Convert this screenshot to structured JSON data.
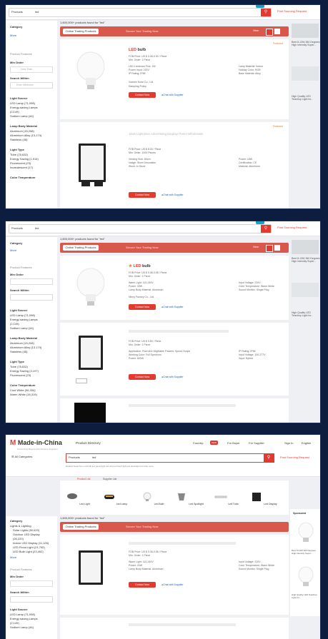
{
  "search": {
    "category": "Products",
    "value": "led"
  },
  "header": {
    "sourcing_request": "Post Sourcing Request"
  },
  "sidebar": {
    "category": "Category",
    "more": "More",
    "product_features": "Product Features",
    "min_order": "Min Order",
    "min_order_placeholder": "Less Than",
    "ok": "OK",
    "search_within": "Search Within",
    "search_within_placeholder": "Enter Attributes",
    "light_source": "Light Source",
    "light_source_items": [
      "LED Lamp (71,098)",
      "Energy-saving Lamps",
      "(2,149)",
      "Sodium Lamp (44)"
    ],
    "lamp_body_material": "Lamp Body Material",
    "lamp_body_items": [
      "Aluminum (15,208)",
      "Aluminium Alloy (13,174)",
      "Stainless (45)"
    ],
    "light_type": "Light Type",
    "light_type_items": [
      "Tube (75,632)",
      "Energy Saving (1,914)",
      "Fluorescent (23)",
      "Incandescent (17)"
    ],
    "color_temperature": "Color Temperature"
  },
  "main": {
    "count_text": "1,600,000+ products found for \"led\"",
    "tab_online": "Online Trading Products",
    "tab_promo": "Secure Your Trading Now",
    "view_label": "View:",
    "featured": "Featured",
    "product1": {
      "title_emph": "LED",
      "title_rest": " bulb",
      "price": "FOB Price: US $ 0.08-0.30 / Piece",
      "min_order": "Min. Order: 1 Piece",
      "lines_left": [
        "LED Luminous Flux: 1W",
        "Power Input: 220V",
        "IP Rating: IP65"
      ],
      "lines_right": [
        "Lamp Material: Indoor",
        "Holiday Color: RGB",
        "Base Material: Alloy"
      ],
      "supplier": "Xiamen Solar Co., Ltd.",
      "sampling": "Sampling Policy",
      "contact": "Contact Now",
      "chat": "Chat with Supplier"
    },
    "product2": {
      "title_blur": "10x8 Light Box Advertising Display Panel Wholesale",
      "price": "FOB Price: US $ 8.00 / Piece",
      "min_order": "Min. Order: 1000 Pieces",
      "lines_left": [
        "Viewing Size: 80cm",
        "Usage: Store Decoration",
        "Stock: In Stock"
      ],
      "lines_right": [
        "Power: 18W",
        "Certification: CE",
        "Material: Aluminum"
      ],
      "contact": "Contact Now",
      "chat": "Chat with Supplier"
    }
  },
  "right_rail": {
    "ad1": "Bent 8-13W 360 Degrees High Intensity Super...",
    "ad2": "High Quality LED Teardrop Light for..."
  },
  "shot2": {
    "product1": {
      "title_emph": "LED",
      "title_rest": " bulb",
      "price": "FOB Price: US $ 0.06-0.08 / Piece",
      "min_order": "Min. Order: 1 Piece",
      "lines_left": [
        "Warm Light: 110-240V",
        "Power: 20W",
        "Lamp Body Material: Aluminum"
      ],
      "lines_right": [
        "Input Voltage: 220V",
        "Color Temperature: Warm White",
        "Sound Monitor: Single Plug"
      ],
      "supplier": "Ninny Factory Co., Ltd.",
      "contact": "Contact Now",
      "chat": "Chat with Supplier"
    },
    "product2": {
      "price": "FOB Price: US $ 0.80 / Piece",
      "min_order": "Min. Order: 1 Piece",
      "lines_left": [
        "Application: Roof and Vegetable Flowers: Sprout Scope",
        "Working Color: Full Spectrum",
        "Power: 600W"
      ],
      "lines_right": [
        "IP Rating: IP65",
        "Input Voltage: 100-277V",
        "Input: Hybrid"
      ],
      "contact": "Contact Now",
      "chat": "Chat with Supplier"
    },
    "sidebar_extra": [
      "Energy Saving (3,197)",
      "Fluorescent (23)",
      "Cool White (96,334)",
      "Warm White (16,319)"
    ]
  },
  "shot3": {
    "logo": "Made-in-China",
    "logo_tag": "Connecting Buyers with Chinese Suppliers",
    "directory": "Product Directory",
    "nav": [
      "Country:",
      "For Buyer",
      "For Supplier",
      "Sign In",
      "English"
    ],
    "nav_badge": "NEW",
    "all_categories": "All Categories",
    "tags": "Related Searches: led bulb  led panel light  led strip  led flood light  led downlight  led tube  more",
    "tabs": [
      "Product List",
      "Supplier List"
    ],
    "categories": [
      "Led Light",
      "Led Lamp",
      "Led Bulb",
      "Led Spotlight",
      "Led Tube",
      "Led Display"
    ],
    "sponsored": "Sponsored",
    "sponsored_ads": [
      "Bent 8-13W 360 Degrees High Intensity Super...",
      "High Quality LED Teardrop Light for..."
    ],
    "sidebar_cats": [
      "Lights & Lighting",
      "Solar Lights (50,620)",
      "Outdoor LED Display",
      "(26,220)",
      "Indoor LED Display (11,126)",
      "LED Flood Light (21,700)",
      "LED Bulb Light (23,492)"
    ],
    "light_source_items": [
      "LED Lamp (71,098)",
      "Energy-saving Lamps",
      "(2,149)",
      "Sodium Lamp (44)"
    ]
  },
  "colors": {
    "accent": "#e23a2e",
    "link": "#1f5fae",
    "promo_bar": "#d9584c",
    "backdrop": "#0d1d3f"
  }
}
